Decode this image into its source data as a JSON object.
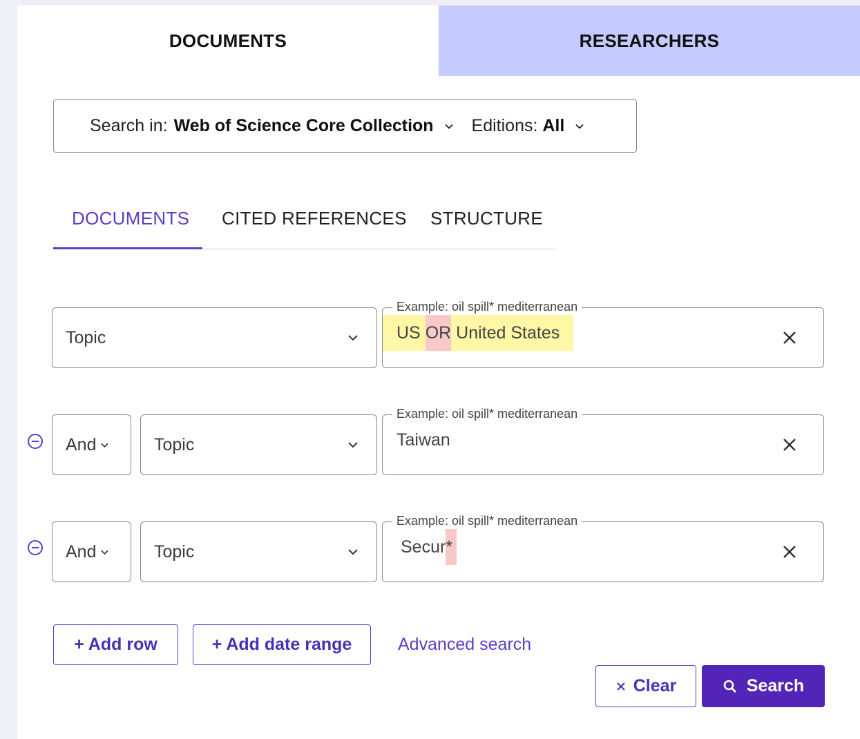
{
  "top_tabs": [
    {
      "label": "DOCUMENTS",
      "active": true
    },
    {
      "label": "RESEARCHERS",
      "active": false
    }
  ],
  "search_in": {
    "label": "Search in:",
    "collection": "Web of Science Core Collection",
    "editions_label": "Editions:",
    "editions_value": "All"
  },
  "sub_tabs": [
    {
      "label": "DOCUMENTS",
      "active": true
    },
    {
      "label": "CITED REFERENCES",
      "active": false
    },
    {
      "label": "STRUCTURE",
      "active": false
    }
  ],
  "rows": [
    {
      "field": "Topic",
      "placeholder": "Example: oil spill* mediterranean",
      "query_parts": [
        "US",
        " ",
        "OR",
        " ",
        "United States"
      ]
    },
    {
      "bool": "And",
      "field": "Topic",
      "placeholder": "Example: oil spill* mediterranean",
      "query": "Taiwan"
    },
    {
      "bool": "And",
      "field": "Topic",
      "placeholder": "Example: oil spill* mediterranean",
      "query_parts": [
        "Secur",
        "*"
      ]
    }
  ],
  "actions": {
    "add_row": "+ Add row",
    "add_date_range": "+ Add date range",
    "advanced_search": "Advanced search",
    "clear": "Clear",
    "search": "Search"
  },
  "colors": {
    "accent": "#5b3ec8",
    "primary_button": "#5225b8",
    "inactive_tab": "#c5caff",
    "highlight_term": "#fdf7a6",
    "highlight_operator": "#f9c9c9"
  }
}
